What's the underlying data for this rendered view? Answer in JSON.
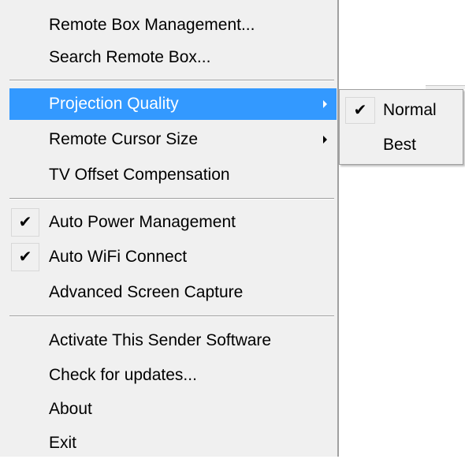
{
  "menu": {
    "items": [
      {
        "label": "Remote Box Management...",
        "checked": false,
        "submenu": false,
        "highlighted": false
      },
      {
        "label": "Search Remote Box...",
        "checked": false,
        "submenu": false,
        "highlighted": false
      },
      {
        "label": "Projection Quality",
        "checked": false,
        "submenu": true,
        "highlighted": true
      },
      {
        "label": "Remote Cursor Size",
        "checked": false,
        "submenu": true,
        "highlighted": false
      },
      {
        "label": "TV Offset Compensation",
        "checked": false,
        "submenu": false,
        "highlighted": false
      },
      {
        "label": "Auto Power Management",
        "checked": true,
        "submenu": false,
        "highlighted": false
      },
      {
        "label": "Auto WiFi Connect",
        "checked": true,
        "submenu": false,
        "highlighted": false
      },
      {
        "label": "Advanced Screen Capture",
        "checked": false,
        "submenu": false,
        "highlighted": false
      },
      {
        "label": "Activate This Sender Software",
        "checked": false,
        "submenu": false,
        "highlighted": false
      },
      {
        "label": "Check for updates...",
        "checked": false,
        "submenu": false,
        "highlighted": false
      },
      {
        "label": "About",
        "checked": false,
        "submenu": false,
        "highlighted": false
      },
      {
        "label": "Exit",
        "checked": false,
        "submenu": false,
        "highlighted": false
      }
    ],
    "check_glyph": "✔",
    "highlight_color": "#3399ff"
  },
  "submenu": {
    "items": [
      {
        "label": "Normal",
        "checked": true
      },
      {
        "label": "Best",
        "checked": false
      }
    ]
  }
}
